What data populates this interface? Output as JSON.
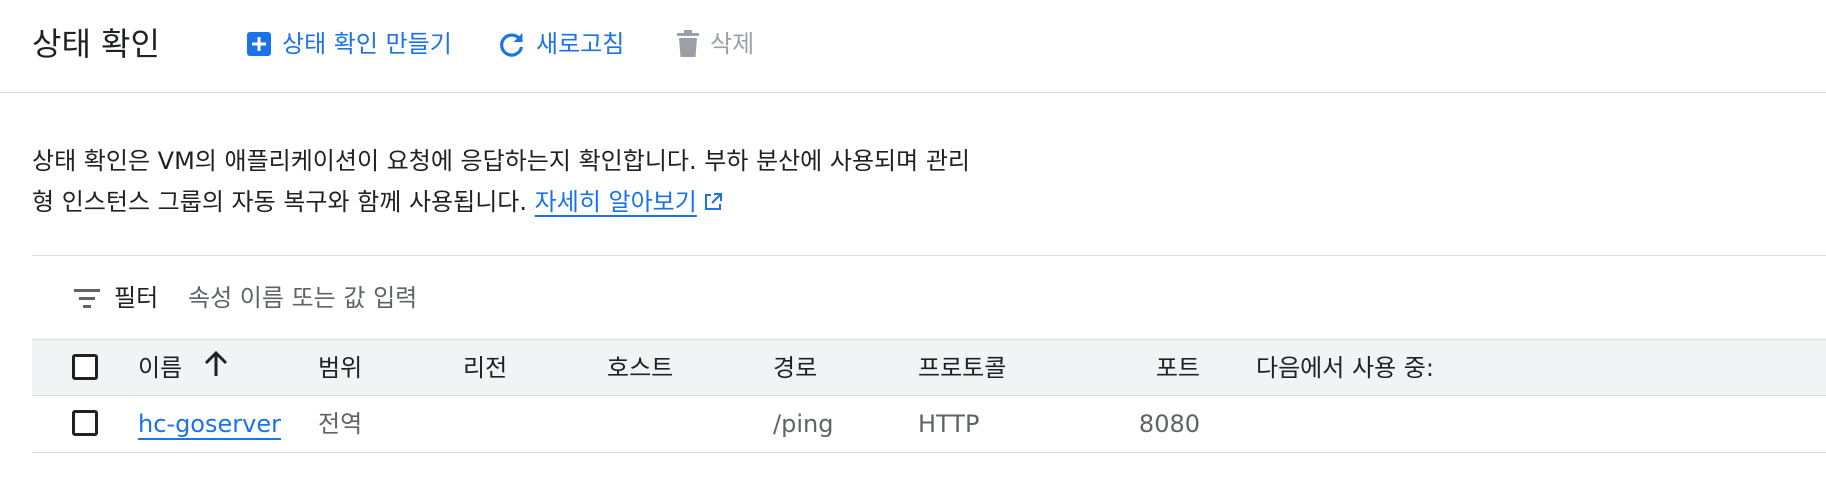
{
  "header": {
    "title": "상태 확인",
    "create_label": "상태 확인 만들기",
    "refresh_label": "새로고침",
    "delete_label": "삭제"
  },
  "description": {
    "line1": "상태 확인은 VM의 애플리케이션이 요청에 응답하는지 확인합니다. 부하 분산에 사용되며 관리",
    "line2": "형 인스턴스 그룹의 자동 복구와 함께 사용됩니다.",
    "link_label": "자세히 알아보기"
  },
  "filter": {
    "label": "필터",
    "placeholder": "속성 이름 또는 값 입력"
  },
  "table": {
    "columns": {
      "name": "이름",
      "scope": "범위",
      "region": "리전",
      "host": "호스트",
      "path": "경로",
      "protocol": "프로토콜",
      "port": "포트",
      "used_by": "다음에서 사용 중:"
    },
    "rows": [
      {
        "name": "hc-goserver",
        "scope": "전역",
        "region": "",
        "host": "",
        "path": "/ping",
        "protocol": "HTTP",
        "port": "8080",
        "used_by": ""
      }
    ]
  },
  "icons": {
    "create": "add-box-icon",
    "refresh": "refresh-icon",
    "delete": "trash-icon",
    "external": "external-link-icon",
    "filter": "filter-icon",
    "sort": "arrow-up-icon"
  },
  "colors": {
    "accent": "#1a73e8",
    "disabled": "#9aa0a6",
    "header_bg": "#f1f3f4",
    "border": "#dadce0"
  }
}
